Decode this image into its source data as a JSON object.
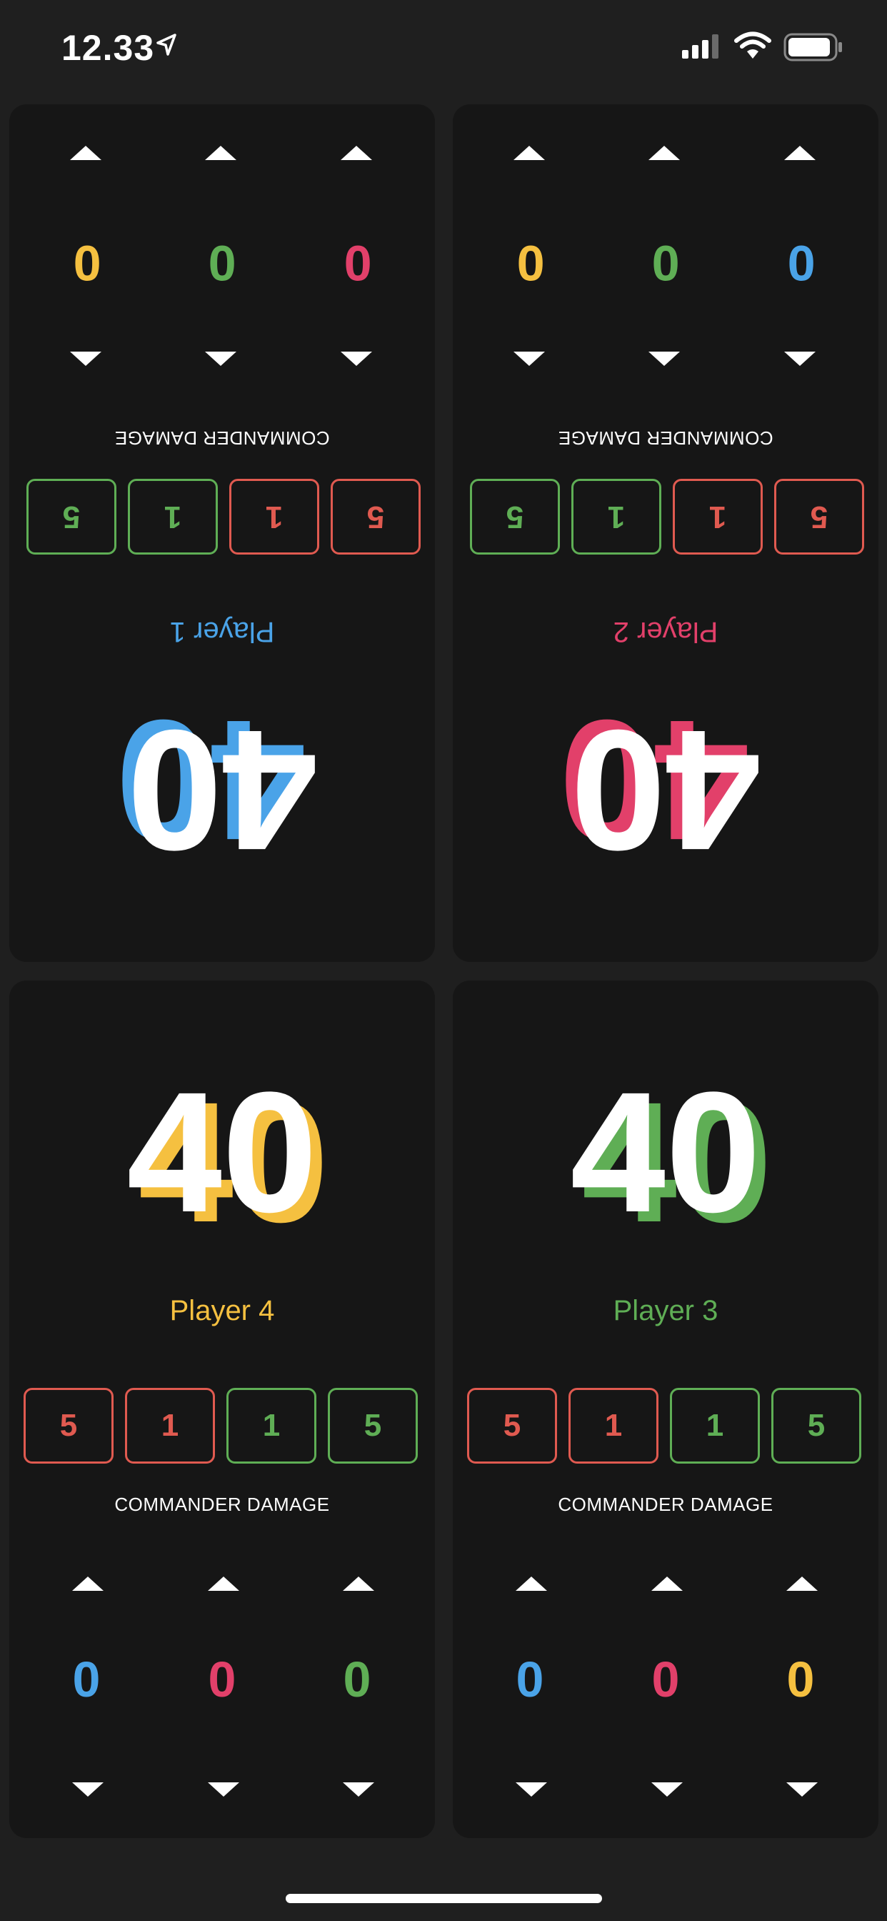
{
  "status_bar": {
    "time": "12.33"
  },
  "commander_damage_label": "COMMANDER DAMAGE",
  "colors": {
    "blue": "#4aa3e8",
    "pink": "#e2406a",
    "yellow": "#f5c040",
    "green": "#5fae55",
    "red_box": "#e05a50",
    "green_box": "#5fae55"
  },
  "players": [
    {
      "name": "Player 1",
      "life": "40",
      "color": "#4aa3e8",
      "boxes": [
        {
          "value": "5",
          "color": "#e05a50"
        },
        {
          "value": "1",
          "color": "#e05a50"
        },
        {
          "value": "1",
          "color": "#5fae55"
        },
        {
          "value": "5",
          "color": "#5fae55"
        }
      ],
      "trackers": [
        {
          "value": "0",
          "color": "#e2406a"
        },
        {
          "value": "0",
          "color": "#5fae55"
        },
        {
          "value": "0",
          "color": "#f5c040"
        }
      ]
    },
    {
      "name": "Player 2",
      "life": "40",
      "color": "#e2406a",
      "boxes": [
        {
          "value": "5",
          "color": "#e05a50"
        },
        {
          "value": "1",
          "color": "#e05a50"
        },
        {
          "value": "1",
          "color": "#5fae55"
        },
        {
          "value": "5",
          "color": "#5fae55"
        }
      ],
      "trackers": [
        {
          "value": "0",
          "color": "#4aa3e8"
        },
        {
          "value": "0",
          "color": "#5fae55"
        },
        {
          "value": "0",
          "color": "#f5c040"
        }
      ]
    },
    {
      "name": "Player 4",
      "life": "40",
      "color": "#f5c040",
      "boxes": [
        {
          "value": "5",
          "color": "#e05a50"
        },
        {
          "value": "1",
          "color": "#e05a50"
        },
        {
          "value": "1",
          "color": "#5fae55"
        },
        {
          "value": "5",
          "color": "#5fae55"
        }
      ],
      "trackers": [
        {
          "value": "0",
          "color": "#4aa3e8"
        },
        {
          "value": "0",
          "color": "#e2406a"
        },
        {
          "value": "0",
          "color": "#5fae55"
        }
      ]
    },
    {
      "name": "Player 3",
      "life": "40",
      "color": "#5fae55",
      "boxes": [
        {
          "value": "5",
          "color": "#e05a50"
        },
        {
          "value": "1",
          "color": "#e05a50"
        },
        {
          "value": "1",
          "color": "#5fae55"
        },
        {
          "value": "5",
          "color": "#5fae55"
        }
      ],
      "trackers": [
        {
          "value": "0",
          "color": "#4aa3e8"
        },
        {
          "value": "0",
          "color": "#e2406a"
        },
        {
          "value": "0",
          "color": "#f5c040"
        }
      ]
    }
  ]
}
